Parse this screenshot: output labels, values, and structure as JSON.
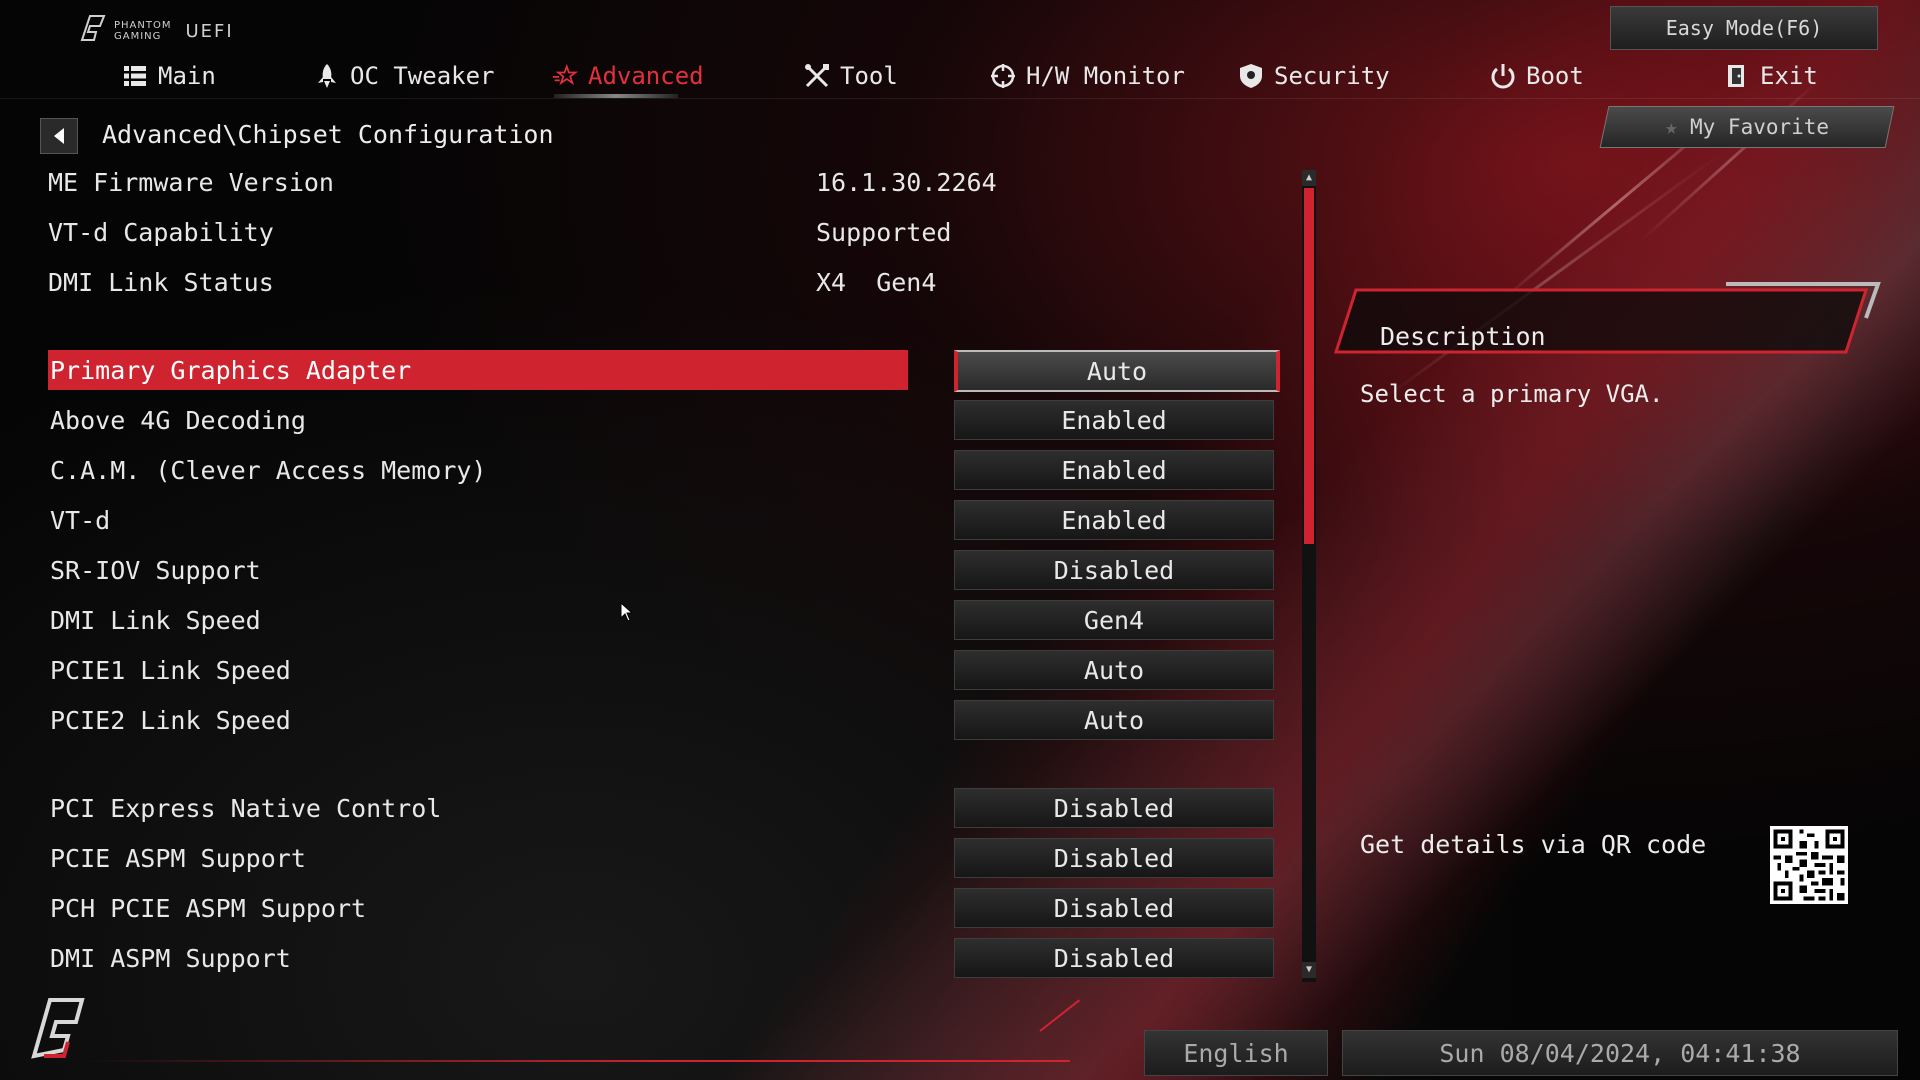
{
  "header": {
    "brand_line1": "PHANTOM",
    "brand_line2": "GAMING",
    "brand_uefi": "UEFI",
    "easy_mode": "Easy Mode(F6)",
    "my_favorite": "My Favorite"
  },
  "nav": {
    "active_tab": "Advanced",
    "tabs": [
      {
        "label": "Main",
        "icon": "list-icon"
      },
      {
        "label": "OC Tweaker",
        "icon": "rocket-icon"
      },
      {
        "label": "Advanced",
        "icon": "star-icon"
      },
      {
        "label": "Tool",
        "icon": "tools-icon"
      },
      {
        "label": "H/W Monitor",
        "icon": "crosshair-icon"
      },
      {
        "label": "Security",
        "icon": "shield-icon"
      },
      {
        "label": "Boot",
        "icon": "power-icon"
      },
      {
        "label": "Exit",
        "icon": "exit-door-icon"
      }
    ]
  },
  "breadcrumb": "Advanced\\Chipset Configuration",
  "info": [
    {
      "label": "ME Firmware Version",
      "value": "16.1.30.2264"
    },
    {
      "label": "VT-d Capability",
      "value": "Supported"
    },
    {
      "label": "DMI Link Status",
      "value": "X4  Gen4"
    }
  ],
  "settings": [
    {
      "label": "Primary Graphics Adapter",
      "value": "Auto",
      "selected": true
    },
    {
      "label": "Above 4G Decoding",
      "value": "Enabled"
    },
    {
      "label": "C.A.M. (Clever Access Memory)",
      "value": "Enabled"
    },
    {
      "label": "VT-d",
      "value": "Enabled"
    },
    {
      "label": "SR-IOV Support",
      "value": "Disabled"
    },
    {
      "label": "DMI Link Speed",
      "value": "Gen4"
    },
    {
      "label": "PCIE1 Link Speed",
      "value": "Auto"
    },
    {
      "label": "PCIE2 Link Speed",
      "value": "Auto"
    },
    {
      "label": "PCI Express Native Control",
      "value": "Disabled"
    },
    {
      "label": "PCIE ASPM Support",
      "value": "Disabled"
    },
    {
      "label": "PCH PCIE ASPM Support",
      "value": "Disabled"
    },
    {
      "label": "DMI ASPM Support",
      "value": "Disabled"
    }
  ],
  "description": {
    "title": "Description",
    "text": "Select a primary VGA.",
    "qr_label": "Get details via QR code"
  },
  "footer": {
    "language": "English",
    "datetime": "Sun 08/04/2024, 04:41:38"
  },
  "colors": {
    "accent": "#cf2430",
    "background": "#050505",
    "text": "#e8e8e8"
  }
}
